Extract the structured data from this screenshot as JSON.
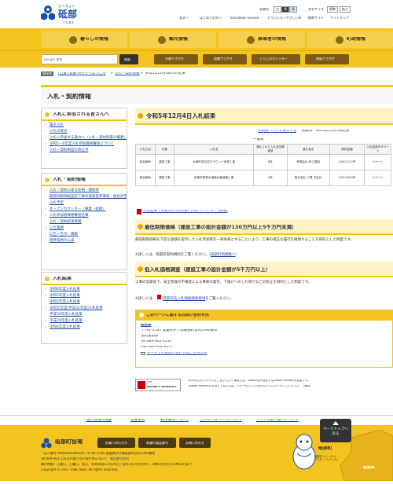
{
  "header": {
    "logo_kana": "とべ ちょう",
    "logo_kanji": "砥部",
    "logo_roman": "TOBE",
    "bg_color_label": "背景色",
    "bg_white": "白",
    "bg_black": "黒",
    "bg_blue": "青",
    "font_size_label": "文字サイズ",
    "font_standard": "標準",
    "font_large": "拡大",
    "links": [
      "本文へ",
      "はじめての方へ",
      "Translation service",
      "とべいいモノやさしい町",
      "携帯サイト",
      "サイトマップ"
    ]
  },
  "nav": [
    {
      "label": "暮らしの情報"
    },
    {
      "label": "観光情報"
    },
    {
      "label": "事業者の情報"
    },
    {
      "label": "町政情報"
    }
  ],
  "search": {
    "placeholder": "Google 提供",
    "button": "検索"
  },
  "tools": [
    "分類でさがす",
    "組織でさがす",
    "くらしのカレンダー",
    "地図でさがす"
  ],
  "breadcrumb": {
    "label": "現在地",
    "items": [
      "[位置]-愛媛-あそびへようこそ",
      "入札・契約情報",
      "令和5年12月4日入札結果"
    ]
  },
  "page_title": "入札・契約情報",
  "sidebar": {
    "sec1": {
      "title": "入札に参加される皆さんへ",
      "items": [
        "電子入札",
        "入札の様式",
        "入札に参加する論力へ（入札・契約制度の概要）",
        "令和5・6年度入札参加資格審査について",
        "入札・契約制度の改正点"
      ]
    },
    "sec2": {
      "title": "入札・契約情報",
      "items": [
        "入札・契約に係る条例・規則等",
        "最低制限価格設定工事の調査基準価格・総合評定値通知書",
        "入札予定",
        "オープンカウンター（事業・総務）",
        "入札参加者資格審査名簿",
        "入札・契約結果情報",
        "公告業務",
        "公告・告示・募集",
        "随意契約の公表"
      ]
    },
    "sec3": {
      "title": "入札結果",
      "items": [
        "令和6年度入札結果",
        "令和5年度入札結果",
        "令和2年度入札結果",
        "令和元年度(平成31年度)入札結果",
        "平成30年度入札結果",
        "平成29年度入札結果",
        "令和4年度入札結果"
      ]
    }
  },
  "main": {
    "title": "令和5年12月4日入札結果",
    "print_label": "印刷用ページを表示する",
    "updated": "掲載日：2023年12月5日更新",
    "list_label": "一覧表",
    "table": {
      "headers": [
        "入札方法",
        "対象",
        "入札名",
        "落札された入札参加業者数",
        "落札者名",
        "契約金額",
        "入札結果PDFページ"
      ],
      "rows": [
        [
          "指名競争",
          "建設工事",
          "大南町営住宅グラウンド改修工事",
          "6件",
          "有限会社 和工建設",
          "2,633,222円",
          "1ページ"
        ],
        [
          "指名競争",
          "建設工事",
          "田那町簡易水道給水管道路工事",
          "4件",
          "株式会社 工業 式会社",
          "5,673,800円",
          "2ページ"
        ]
      ]
    },
    "pdf_link": "入札結果（令和5年12月4日）[PDFファイル／73KB]",
    "sec_low": {
      "title": "最低制限価格（建設工事の設計金額が130万円以上5千万円未満）",
      "body": "最低制限価格を下回る金額を提示した入札参加者を一律失格とすることにより、工事の適正な履行を確保することを目的とした制度です。",
      "more": "※詳しくは、砥部町契約規則をご覧ください。（",
      "more_link": "砥部町例規集へ",
      "more_end": "）"
    },
    "sec_survey": {
      "title": "低入札価格調査（建設工事の設計金額が5千万円以上）",
      "body": "工事の品質低下、安全管理の不徹底による事故の発生、下請けへのしわ寄せなどの防止を目的とした制度です。",
      "more": "※詳しくは、",
      "more_link": "砥部町低入札価格調査要領",
      "more_end": "をご覧ください。"
    },
    "contact": {
      "title": "このページに関するお問い合わせ先",
      "dept": "総務課",
      "address": "〒791-2195 愛媛県伊予郡砥部町宮内1392番地",
      "section": "契約業務係",
      "tel": "Tel:089-962-6110",
      "fax": "Fax:089-962-4277",
      "mail": "メールでのお問い合わせはこちらから"
    },
    "adobe": {
      "badge_top": "Get",
      "badge": "ADOBE® READER®",
      "line1": "PDF形式のファイルをご覧いただく場合には、Adobe社が提供するAdobe Readerが必要です。",
      "line2": "Adobe Readerをお持ちでない方は、バナーのリンク先からダウンロードしてください。（無料）"
    }
  },
  "footer_nav": [
    "個人情報の保護",
    "免責事項",
    "著作権等について",
    "このホームページについて",
    "リンクの取り扱いについて"
  ],
  "to_top": "ページトップへ戻る",
  "footer": {
    "office": "砥部町役場",
    "buttons": [
      "役場への行き方",
      "各課の電話番号",
      "お問い合わせ"
    ],
    "corp": "（法人番号 4000020384020）〒791-2195 愛媛県伊予郡砥部町宮内1392番地",
    "tel": "Tel:089-962-2323(代表) Fax:089-962-4277",
    "tel_link": "電話番号案内",
    "hours": "開庁時間：土曜日、日曜日、祝日、年末年始(12月29日～翌年1月3日)を除く、8時30分から17時15分まで",
    "copyright": "Copyright © 2017 Tobe Town, All rights reserved.",
    "mascot_caption": "砥部町イメージキャラクター「とべっち」",
    "mascot_label": "砥部町",
    "pref": "愛媛県"
  }
}
